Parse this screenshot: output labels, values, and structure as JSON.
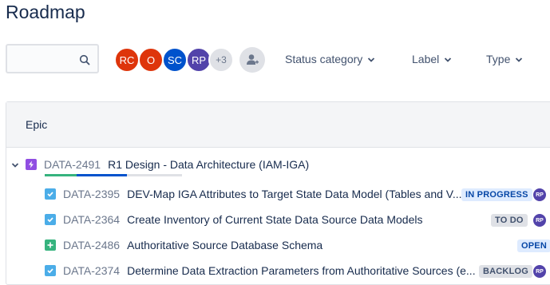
{
  "page": {
    "title": "Roadmap"
  },
  "search": {
    "placeholder": ""
  },
  "avatars": [
    {
      "initials": "RC",
      "color": "#de350b"
    },
    {
      "initials": "O",
      "color": "#de350b"
    },
    {
      "initials": "SC",
      "color": "#0052cc"
    },
    {
      "initials": "RP",
      "color": "#5243aa"
    }
  ],
  "avatar_overflow": "+3",
  "filters": {
    "status_category": "Status category",
    "label": "Label",
    "type": "Type"
  },
  "table": {
    "column_header": "Epic",
    "epic": {
      "key": "DATA-2491",
      "summary": "R1 Design - Data Architecture (IAM-IGA)",
      "icon": "epic-icon",
      "progress": {
        "done": 0.23,
        "in_progress": 0.37,
        "todo": 0.4
      }
    },
    "issues": [
      {
        "key": "DATA-2395",
        "summary": "DEV-Map IGA Attributes to Target State Data Model (Tables and V...",
        "status": "IN PROGRESS",
        "assignee": "RP",
        "type": "task"
      },
      {
        "key": "DATA-2364",
        "summary": "Create Inventory of Current State Data Source Data Models",
        "status": "TO DO",
        "assignee": "RP",
        "type": "task"
      },
      {
        "key": "DATA-2486",
        "summary": "Authoritative Source Database Schema",
        "status": "OPEN",
        "assignee": "",
        "type": "story"
      },
      {
        "key": "DATA-2374",
        "summary": "Determine Data Extraction Parameters from Authoritative Sources (e...",
        "status": "BACKLOG",
        "assignee": "RP",
        "type": "task"
      }
    ]
  },
  "colors": {
    "in_progress_bg": "#deebff",
    "in_progress_fg": "#0747a6",
    "todo_bg": "#dfe1e6",
    "todo_fg": "#42526e",
    "open_bg": "#deebff",
    "open_fg": "#0747a6",
    "task": "#4bade8",
    "story": "#36b37e",
    "epic": "#904ee2"
  }
}
